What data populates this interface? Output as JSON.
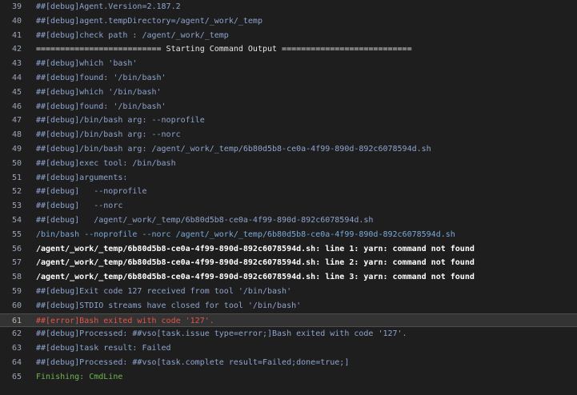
{
  "log": {
    "lines": [
      {
        "num": "39",
        "text": "##[debug]Agent.Version=2.187.2",
        "style": "debug"
      },
      {
        "num": "40",
        "text": "##[debug]agent.tempDirectory=/agent/_work/_temp",
        "style": "debug"
      },
      {
        "num": "41",
        "text": "##[debug]check path : /agent/_work/_temp",
        "style": "debug"
      },
      {
        "num": "42",
        "text": "========================== Starting Command Output ===========================",
        "style": "section"
      },
      {
        "num": "43",
        "text": "##[debug]which 'bash'",
        "style": "debug"
      },
      {
        "num": "44",
        "text": "##[debug]found: '/bin/bash'",
        "style": "debug"
      },
      {
        "num": "45",
        "text": "##[debug]which '/bin/bash'",
        "style": "debug"
      },
      {
        "num": "46",
        "text": "##[debug]found: '/bin/bash'",
        "style": "debug"
      },
      {
        "num": "47",
        "text": "##[debug]/bin/bash arg: --noprofile",
        "style": "debug"
      },
      {
        "num": "48",
        "text": "##[debug]/bin/bash arg: --norc",
        "style": "debug"
      },
      {
        "num": "49",
        "text": "##[debug]/bin/bash arg: /agent/_work/_temp/6b80d5b8-ce0a-4f99-890d-892c6078594d.sh",
        "style": "debug"
      },
      {
        "num": "50",
        "text": "##[debug]exec tool: /bin/bash",
        "style": "debug"
      },
      {
        "num": "51",
        "text": "##[debug]arguments:",
        "style": "debug"
      },
      {
        "num": "52",
        "text": "##[debug]   --noprofile",
        "style": "debug"
      },
      {
        "num": "53",
        "text": "##[debug]   --norc",
        "style": "debug"
      },
      {
        "num": "54",
        "text": "##[debug]   /agent/_work/_temp/6b80d5b8-ce0a-4f99-890d-892c6078594d.sh",
        "style": "debug"
      },
      {
        "num": "55",
        "text": "/bin/bash --noprofile --norc /agent/_work/_temp/6b80d5b8-ce0a-4f99-890d-892c6078594d.sh",
        "style": "cmd"
      },
      {
        "num": "56",
        "text": "/agent/_work/_temp/6b80d5b8-ce0a-4f99-890d-892c6078594d.sh: line 1: yarn: command not found",
        "style": "strong"
      },
      {
        "num": "57",
        "text": "/agent/_work/_temp/6b80d5b8-ce0a-4f99-890d-892c6078594d.sh: line 2: yarn: command not found",
        "style": "strong"
      },
      {
        "num": "58",
        "text": "/agent/_work/_temp/6b80d5b8-ce0a-4f99-890d-892c6078594d.sh: line 3: yarn: command not found",
        "style": "strong"
      },
      {
        "num": "59",
        "text": "##[debug]Exit code 127 received from tool '/bin/bash'",
        "style": "debug"
      },
      {
        "num": "60",
        "text": "##[debug]STDIO streams have closed for tool '/bin/bash'",
        "style": "debug"
      },
      {
        "num": "61",
        "text": "##[error]Bash exited with code '127'.",
        "style": "error",
        "selected": true
      },
      {
        "num": "62",
        "text": "##[debug]Processed: ##vso[task.issue type=error;]Bash exited with code '127'.",
        "style": "debug"
      },
      {
        "num": "63",
        "text": "##[debug]task result: Failed",
        "style": "debug"
      },
      {
        "num": "64",
        "text": "##[debug]Processed: ##vso[task.complete result=Failed;done=true;]",
        "style": "debug"
      },
      {
        "num": "65",
        "text": "Finishing: CmdLine",
        "style": "success"
      }
    ]
  },
  "colors": {
    "background": "#1e1e1e",
    "debug": "#8ea4cf",
    "error": "#e5534b",
    "success": "#6fb553",
    "command": "#7da9d8"
  }
}
